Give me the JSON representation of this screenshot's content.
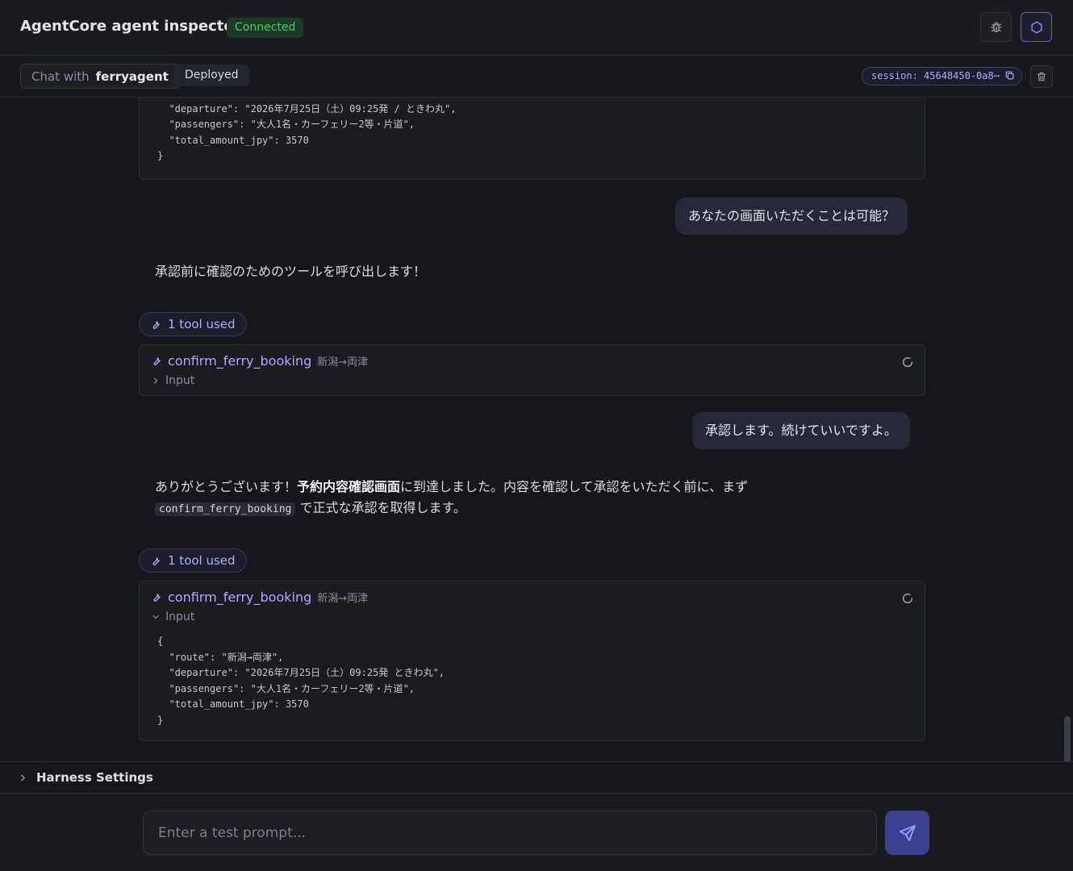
{
  "header": {
    "title": "AgentCore agent inspector",
    "status": "Connected",
    "colors": {
      "status": "#3fcf6a",
      "accent": "#5b5fd6"
    },
    "icons": [
      "bug-icon",
      "hexagon-icon"
    ]
  },
  "subbar": {
    "chat_with_prefix": "Chat with",
    "agent_name": "ferryagent",
    "deployed_label": "Deployed",
    "session_text": "session: 45648450-0a8⋯"
  },
  "messages": {
    "top_code": "  \"route\": \"新潟→両津\",\n  \"departure\": \"2026年7月25日（土）09:25発 / ときわ丸\",\n  \"passengers\": \"大人1名・カーフェリー2等・片道\",\n  \"total_amount_jpy\": 3570\n}",
    "user_1": "あなたの画面いただくことは可能？",
    "assistant_1": "承認前に確認のためのツールを呼び出します！",
    "tool_used_label_1": "1 tool used",
    "tool_1": {
      "name": "confirm_ferry_booking",
      "route": "新潟→両津",
      "input_label": "Input",
      "expanded": false
    },
    "user_2": "承認します。続けていいですよ。",
    "assistant_2": {
      "part1": "ありがとうございます！",
      "bold": "予約内容確認画面",
      "part2": "に到達しました。内容を確認して承認をいただく前に、まず",
      "code": "confirm_ferry_booking",
      "part3": "で正式な承認を取得します。"
    },
    "tool_used_label_2": "1 tool used",
    "tool_2": {
      "name": "confirm_ferry_booking",
      "route": "新潟→両津",
      "input_label": "Input",
      "expanded": true,
      "input_json": "{\n  \"route\": \"新潟→両津\",\n  \"departure\": \"2026年7月25日（土）09:25発 ときわ丸\",\n  \"passengers\": \"大人1名・カーフェリー2等・片道\",\n  \"total_amount_jpy\": 3570\n}"
    }
  },
  "harness": {
    "label": "Harness Settings"
  },
  "composer": {
    "placeholder": "Enter a test prompt..."
  }
}
